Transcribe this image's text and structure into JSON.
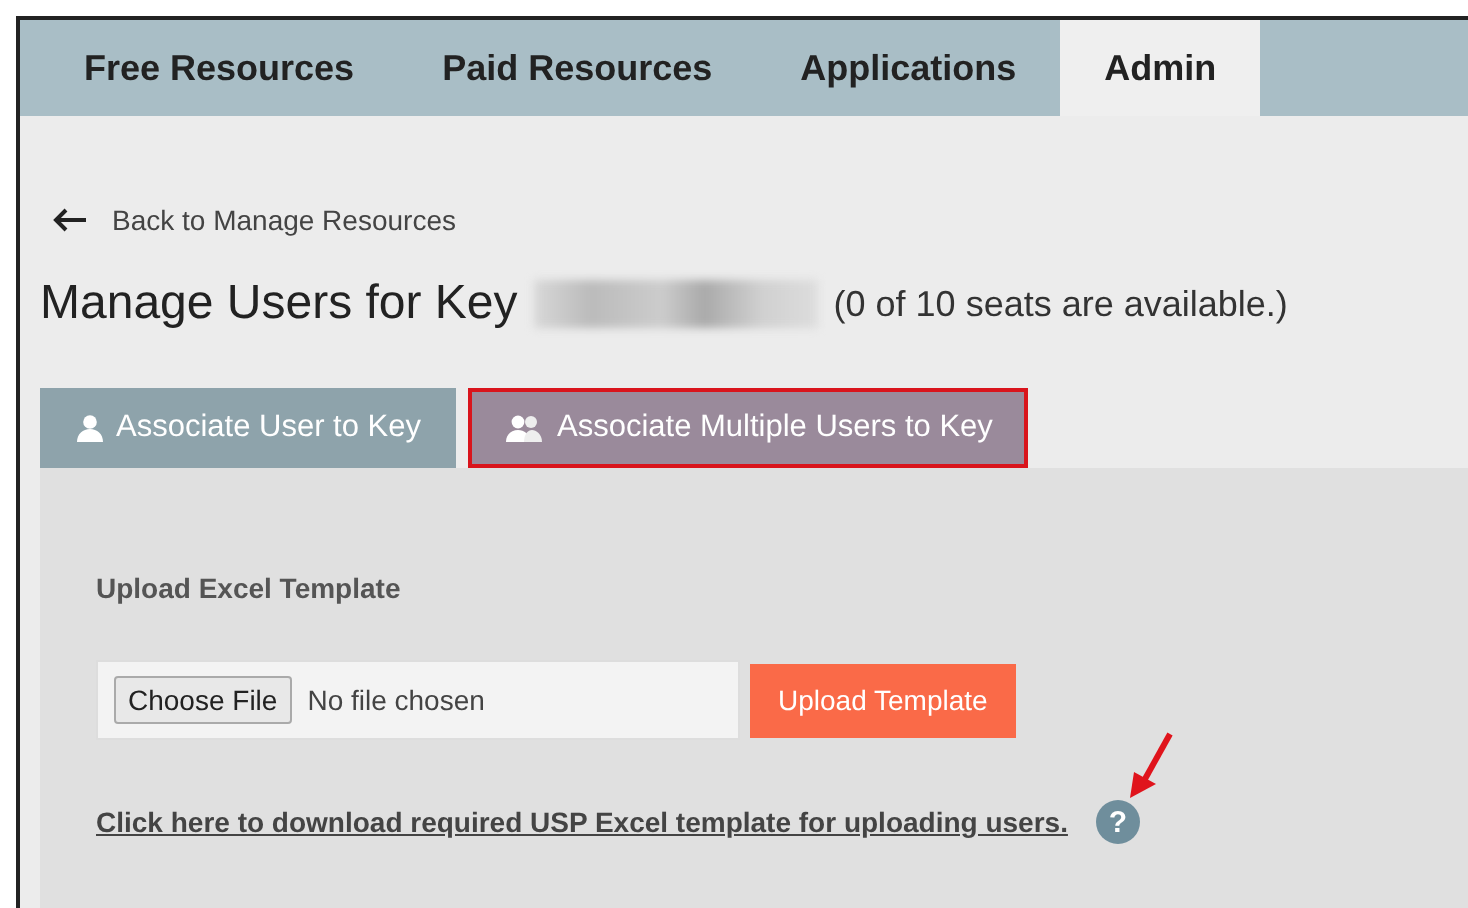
{
  "nav": {
    "items": [
      {
        "label": "Free Resources",
        "selected": false
      },
      {
        "label": "Paid Resources",
        "selected": false
      },
      {
        "label": "Applications",
        "selected": false
      },
      {
        "label": "Admin",
        "selected": true
      }
    ]
  },
  "back_link": "Back to Manage Resources",
  "heading": {
    "title": "Manage Users for Key",
    "seats": "(0 of 10 seats are available.)"
  },
  "tabs": [
    {
      "label": "Associate User to Key",
      "kind": "single",
      "selected": false,
      "highlighted": false
    },
    {
      "label": "Associate Multiple Users to Key",
      "kind": "multiple",
      "selected": true,
      "highlighted": true
    }
  ],
  "upload": {
    "label": "Upload Excel Template",
    "choose_button": "Choose File",
    "file_status": "No file chosen",
    "upload_button": "Upload Template"
  },
  "download_link": "Click here to download required USP Excel template for uploading users.",
  "help_icon": "?"
}
